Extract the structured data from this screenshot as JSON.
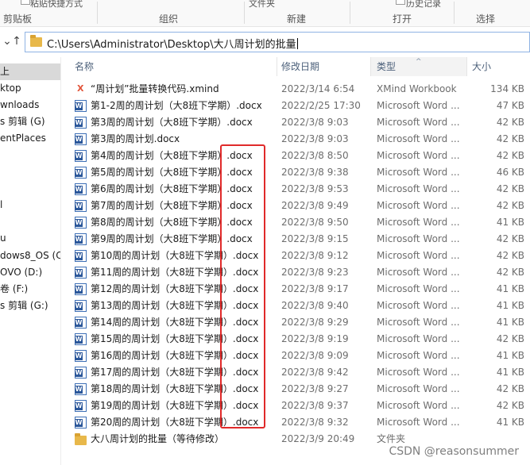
{
  "ribbon": {
    "cut_label": "粘贴快捷方式",
    "cut_label2": "文件夹",
    "cut_label3": "历史记录",
    "groups": [
      "剪贴板",
      "组织",
      "新建",
      "打开",
      "选择"
    ]
  },
  "address": {
    "path": "C:\\Users\\Administrator\\Desktop\\大八周计划的批量"
  },
  "nav": {
    "items": [
      "上",
      "ktop",
      "wnloads",
      "s 剪辑 (G)",
      "entPlaces",
      "",
      "",
      "l",
      "",
      "u",
      "dows8_OS (C",
      "OVO (D:)",
      "卷 (F:)",
      "s 剪辑 (G:)"
    ]
  },
  "columns": {
    "name": "名称",
    "date": "修改日期",
    "type": "类型",
    "size": "大小"
  },
  "files": [
    {
      "icon": "xmind",
      "name": "“周计划”批量转换代码.xmind",
      "date": "2022/3/14 6:54",
      "type": "XMind Workbook",
      "size": "134 KB"
    },
    {
      "icon": "word",
      "name": "第1-2周的周计划（大8班下学期）.docx",
      "date": "2022/2/25 17:30",
      "type": "Microsoft Word ...",
      "size": "47 KB"
    },
    {
      "icon": "word",
      "name": "第3周的周计划（大8班下学期）.docx",
      "date": "2022/3/8 9:03",
      "type": "Microsoft Word ...",
      "size": "42 KB"
    },
    {
      "icon": "word",
      "name": "第3周的周计划.docx",
      "date": "2022/3/8 9:03",
      "type": "Microsoft Word ...",
      "size": "42 KB"
    },
    {
      "icon": "word",
      "name": "第4周的周计划（大8班下学期）.docx",
      "date": "2022/3/8 8:50",
      "type": "Microsoft Word ...",
      "size": "42 KB"
    },
    {
      "icon": "word",
      "name": "第5周的周计划（大8班下学期）.docx",
      "date": "2022/3/8 9:38",
      "type": "Microsoft Word ...",
      "size": "46 KB"
    },
    {
      "icon": "word",
      "name": "第6周的周计划（大8班下学期）.docx",
      "date": "2022/3/8 9:53",
      "type": "Microsoft Word ...",
      "size": "42 KB"
    },
    {
      "icon": "word",
      "name": "第7周的周计划（大8班下学期）.docx",
      "date": "2022/3/8 9:49",
      "type": "Microsoft Word ...",
      "size": "42 KB"
    },
    {
      "icon": "word",
      "name": "第8周的周计划（大8班下学期）.docx",
      "date": "2022/3/8 9:50",
      "type": "Microsoft Word ...",
      "size": "41 KB"
    },
    {
      "icon": "word",
      "name": "第9周的周计划（大8班下学期）.docx",
      "date": "2022/3/8 9:15",
      "type": "Microsoft Word ...",
      "size": "42 KB"
    },
    {
      "icon": "word",
      "name": "第10周的周计划（大8班下学期）.docx",
      "date": "2022/3/8 9:12",
      "type": "Microsoft Word ...",
      "size": "42 KB"
    },
    {
      "icon": "word",
      "name": "第11周的周计划（大8班下学期）.docx",
      "date": "2022/3/8 9:23",
      "type": "Microsoft Word ...",
      "size": "42 KB"
    },
    {
      "icon": "word",
      "name": "第12周的周计划（大8班下学期）.docx",
      "date": "2022/3/8 9:17",
      "type": "Microsoft Word ...",
      "size": "41 KB"
    },
    {
      "icon": "word",
      "name": "第13周的周计划（大8班下学期）.docx",
      "date": "2022/3/8 9:40",
      "type": "Microsoft Word ...",
      "size": "41 KB"
    },
    {
      "icon": "word",
      "name": "第14周的周计划（大8班下学期）.docx",
      "date": "2022/3/8 9:29",
      "type": "Microsoft Word ...",
      "size": "41 KB"
    },
    {
      "icon": "word",
      "name": "第15周的周计划（大8班下学期）.docx",
      "date": "2022/3/8 9:19",
      "type": "Microsoft Word ...",
      "size": "42 KB"
    },
    {
      "icon": "word",
      "name": "第16周的周计划（大8班下学期）.docx",
      "date": "2022/3/8 9:09",
      "type": "Microsoft Word ...",
      "size": "41 KB"
    },
    {
      "icon": "word",
      "name": "第17周的周计划（大8班下学期）.docx",
      "date": "2022/3/8 9:42",
      "type": "Microsoft Word ...",
      "size": "41 KB"
    },
    {
      "icon": "word",
      "name": "第18周的周计划（大8班下学期）.docx",
      "date": "2022/3/8 9:27",
      "type": "Microsoft Word ...",
      "size": "42 KB"
    },
    {
      "icon": "word",
      "name": "第19周的周计划（大8班下学期）.docx",
      "date": "2022/3/8 9:37",
      "type": "Microsoft Word ...",
      "size": "42 KB"
    },
    {
      "icon": "word",
      "name": "第20周的周计划（大8班下学期）.docx",
      "date": "2022/3/8 9:32",
      "type": "Microsoft Word ...",
      "size": "41 KB"
    },
    {
      "icon": "folder",
      "name": "大八周计划的批量（等待修改）",
      "date": "2022/3/9 20:49",
      "type": "文件夹",
      "size": ""
    }
  ],
  "watermark": "CSDN @reasonsummer",
  "colors": {
    "annotation": "#e02a2a",
    "header_text": "#4c607a",
    "word_blue": "#2b579a",
    "folder_yellow": "#e8b84a"
  }
}
